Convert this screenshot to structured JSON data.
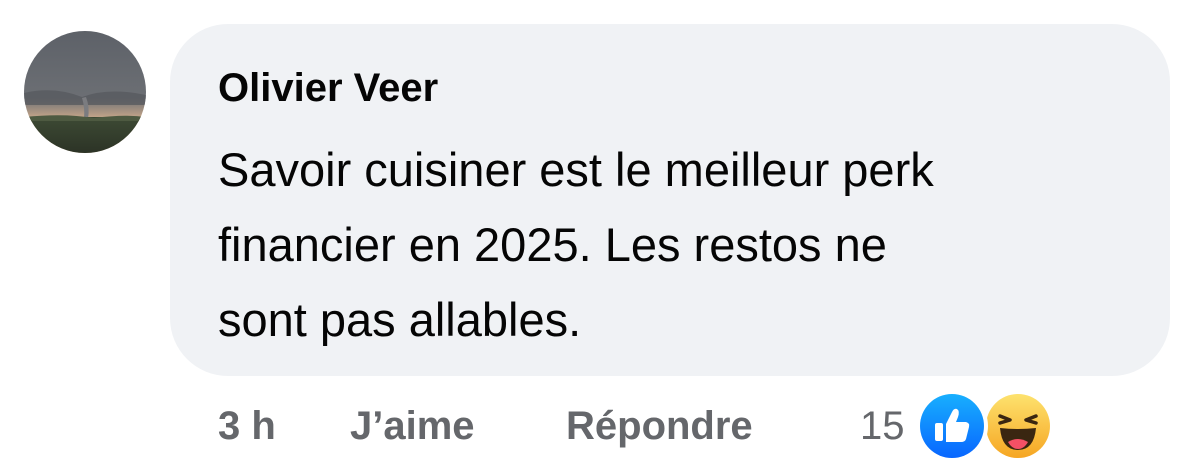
{
  "comment": {
    "author": "Olivier Veer",
    "lines": [
      "Savoir cuisiner est le meilleur perk",
      "financier en 2025. Les restos ne",
      "sont pas allables."
    ]
  },
  "actions": {
    "time": "3 h",
    "like_label": "J’aime",
    "reply_label": "Répondre"
  },
  "reactions": {
    "count": "15",
    "types": [
      "like-icon",
      "haha-icon"
    ]
  },
  "colors": {
    "bubble": "#f0f2f5",
    "secondary_text": "#65676b",
    "like_blue": "#1877f2",
    "haha_yellow": "#f7b928"
  }
}
